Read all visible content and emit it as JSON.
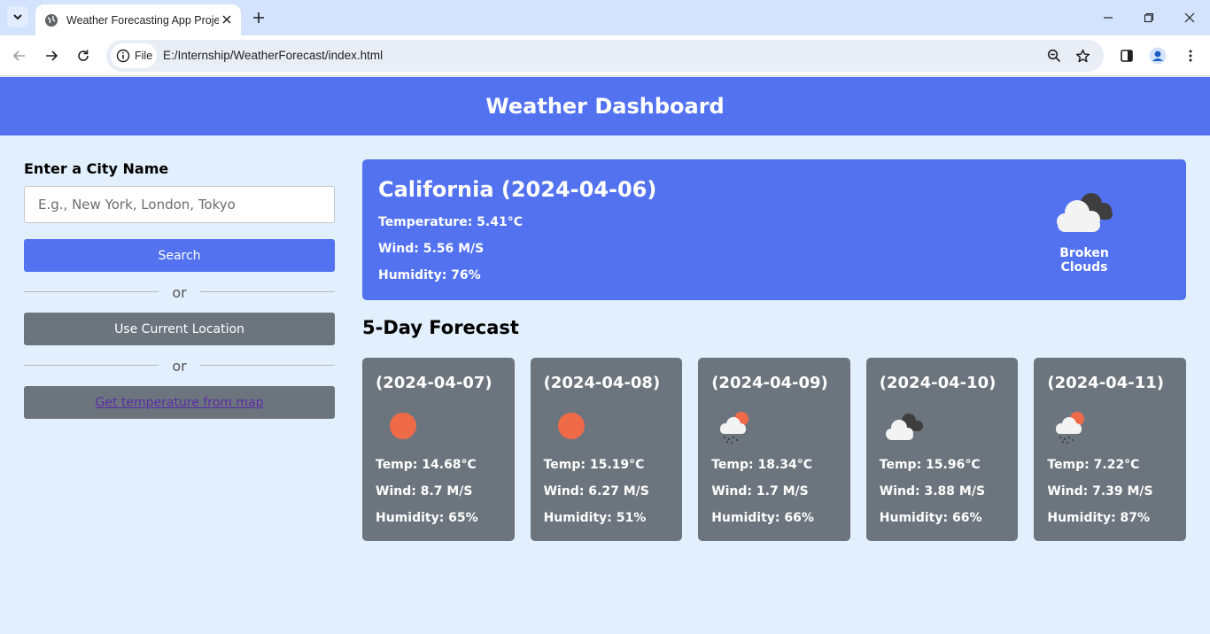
{
  "browser": {
    "tab_title": "Weather Forecasting App Proje",
    "site_chip_label": "File",
    "url": "E:/Internship/WeatherForecast/index.html"
  },
  "page": {
    "header_title": "Weather Dashboard",
    "sidebar": {
      "label": "Enter a City Name",
      "input_placeholder": "E.g., New York, London, Tokyo",
      "input_value": "",
      "search_label": "Search",
      "divider_text": "or",
      "current_location_label": "Use Current Location",
      "map_link_label": "Get temperature from map"
    },
    "current": {
      "title": "California (2024-04-06)",
      "temperature": "Temperature: 5.41°C",
      "wind": "Wind: 5.56 M/S",
      "humidity": "Humidity: 76%",
      "description": "Broken Clouds",
      "icon": "broken-clouds"
    },
    "forecast_title": "5-Day Forecast",
    "forecast": [
      {
        "date": "(2024-04-07)",
        "icon": "sun",
        "temp": "Temp: 14.68°C",
        "wind": "Wind: 8.7 M/S",
        "humidity": "Humidity: 65%"
      },
      {
        "date": "(2024-04-08)",
        "icon": "sun",
        "temp": "Temp: 15.19°C",
        "wind": "Wind: 6.27 M/S",
        "humidity": "Humidity: 51%"
      },
      {
        "date": "(2024-04-09)",
        "icon": "rain-sun",
        "temp": "Temp: 18.34°C",
        "wind": "Wind: 1.7 M/S",
        "humidity": "Humidity: 66%"
      },
      {
        "date": "(2024-04-10)",
        "icon": "broken-clouds",
        "temp": "Temp: 15.96°C",
        "wind": "Wind: 3.88 M/S",
        "humidity": "Humidity: 66%"
      },
      {
        "date": "(2024-04-11)",
        "icon": "rain-sun",
        "temp": "Temp: 7.22°C",
        "wind": "Wind: 7.39 M/S",
        "humidity": "Humidity: 87%"
      }
    ]
  },
  "colors": {
    "primary": "#5372f0",
    "secondary": "#6c757d",
    "page_bg": "#e2effc",
    "sun": "#ef6a47"
  }
}
